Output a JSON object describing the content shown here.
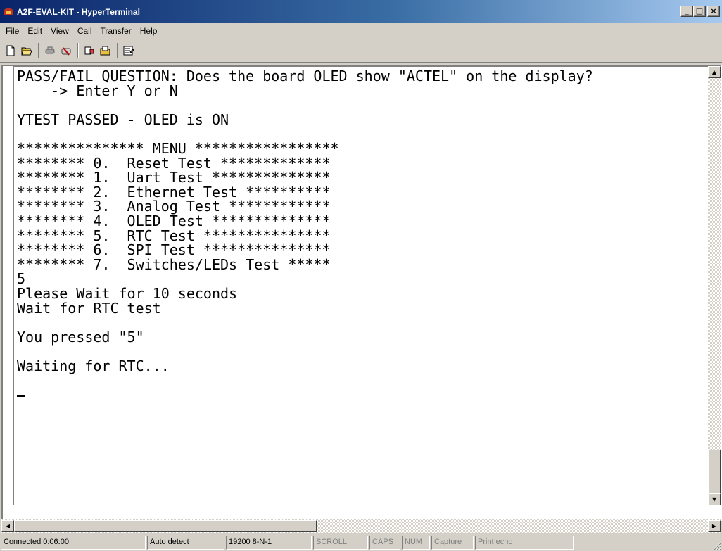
{
  "window": {
    "title": "A2F-EVAL-KIT - HyperTerminal",
    "minimize": "_",
    "maximize": "□",
    "close": "×"
  },
  "menu": [
    "File",
    "Edit",
    "View",
    "Call",
    "Transfer",
    "Help"
  ],
  "toolbar": {
    "icons": [
      "new-icon",
      "open-icon",
      "connect-icon",
      "disconnect-icon",
      "send-icon",
      "receive-icon",
      "properties-icon"
    ]
  },
  "terminal": {
    "lines": [
      "PASS/FAIL QUESTION: Does the board OLED show \"ACTEL\" on the display?",
      "    -> Enter Y or N",
      "",
      "YTEST PASSED - OLED is ON",
      "",
      "*************** MENU *****************",
      "******** 0.  Reset Test *************",
      "******** 1.  Uart Test **************",
      "******** 2.  Ethernet Test **********",
      "******** 3.  Analog Test ************",
      "******** 4.  OLED Test **************",
      "******** 5.  RTC Test ***************",
      "******** 6.  SPI Test ***************",
      "******** 7.  Switches/LEDs Test *****",
      "5",
      "Please Wait for 10 seconds",
      "Wait for RTC test",
      "",
      "You pressed \"5\"",
      "",
      "Waiting for RTC...",
      "",
      ""
    ]
  },
  "status": {
    "connected": "Connected 0:06:00",
    "detect": "Auto detect",
    "port": "19200 8-N-1",
    "scroll": "SCROLL",
    "caps": "CAPS",
    "num": "NUM",
    "capture": "Capture",
    "print_echo": "Print echo"
  }
}
